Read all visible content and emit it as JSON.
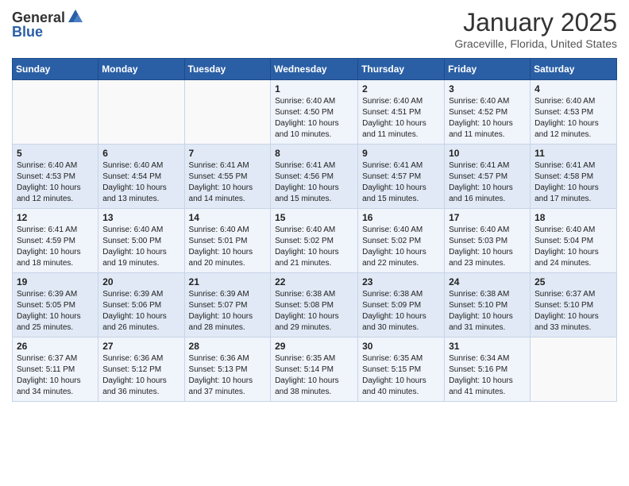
{
  "header": {
    "logo_general": "General",
    "logo_blue": "Blue",
    "month": "January 2025",
    "location": "Graceville, Florida, United States"
  },
  "days_of_week": [
    "Sunday",
    "Monday",
    "Tuesday",
    "Wednesday",
    "Thursday",
    "Friday",
    "Saturday"
  ],
  "weeks": [
    [
      {
        "day": "",
        "info": ""
      },
      {
        "day": "",
        "info": ""
      },
      {
        "day": "",
        "info": ""
      },
      {
        "day": "1",
        "info": "Sunrise: 6:40 AM\nSunset: 4:50 PM\nDaylight: 10 hours and 10 minutes."
      },
      {
        "day": "2",
        "info": "Sunrise: 6:40 AM\nSunset: 4:51 PM\nDaylight: 10 hours and 11 minutes."
      },
      {
        "day": "3",
        "info": "Sunrise: 6:40 AM\nSunset: 4:52 PM\nDaylight: 10 hours and 11 minutes."
      },
      {
        "day": "4",
        "info": "Sunrise: 6:40 AM\nSunset: 4:53 PM\nDaylight: 10 hours and 12 minutes."
      }
    ],
    [
      {
        "day": "5",
        "info": "Sunrise: 6:40 AM\nSunset: 4:53 PM\nDaylight: 10 hours and 12 minutes."
      },
      {
        "day": "6",
        "info": "Sunrise: 6:40 AM\nSunset: 4:54 PM\nDaylight: 10 hours and 13 minutes."
      },
      {
        "day": "7",
        "info": "Sunrise: 6:41 AM\nSunset: 4:55 PM\nDaylight: 10 hours and 14 minutes."
      },
      {
        "day": "8",
        "info": "Sunrise: 6:41 AM\nSunset: 4:56 PM\nDaylight: 10 hours and 15 minutes."
      },
      {
        "day": "9",
        "info": "Sunrise: 6:41 AM\nSunset: 4:57 PM\nDaylight: 10 hours and 15 minutes."
      },
      {
        "day": "10",
        "info": "Sunrise: 6:41 AM\nSunset: 4:57 PM\nDaylight: 10 hours and 16 minutes."
      },
      {
        "day": "11",
        "info": "Sunrise: 6:41 AM\nSunset: 4:58 PM\nDaylight: 10 hours and 17 minutes."
      }
    ],
    [
      {
        "day": "12",
        "info": "Sunrise: 6:41 AM\nSunset: 4:59 PM\nDaylight: 10 hours and 18 minutes."
      },
      {
        "day": "13",
        "info": "Sunrise: 6:40 AM\nSunset: 5:00 PM\nDaylight: 10 hours and 19 minutes."
      },
      {
        "day": "14",
        "info": "Sunrise: 6:40 AM\nSunset: 5:01 PM\nDaylight: 10 hours and 20 minutes."
      },
      {
        "day": "15",
        "info": "Sunrise: 6:40 AM\nSunset: 5:02 PM\nDaylight: 10 hours and 21 minutes."
      },
      {
        "day": "16",
        "info": "Sunrise: 6:40 AM\nSunset: 5:02 PM\nDaylight: 10 hours and 22 minutes."
      },
      {
        "day": "17",
        "info": "Sunrise: 6:40 AM\nSunset: 5:03 PM\nDaylight: 10 hours and 23 minutes."
      },
      {
        "day": "18",
        "info": "Sunrise: 6:40 AM\nSunset: 5:04 PM\nDaylight: 10 hours and 24 minutes."
      }
    ],
    [
      {
        "day": "19",
        "info": "Sunrise: 6:39 AM\nSunset: 5:05 PM\nDaylight: 10 hours and 25 minutes."
      },
      {
        "day": "20",
        "info": "Sunrise: 6:39 AM\nSunset: 5:06 PM\nDaylight: 10 hours and 26 minutes."
      },
      {
        "day": "21",
        "info": "Sunrise: 6:39 AM\nSunset: 5:07 PM\nDaylight: 10 hours and 28 minutes."
      },
      {
        "day": "22",
        "info": "Sunrise: 6:38 AM\nSunset: 5:08 PM\nDaylight: 10 hours and 29 minutes."
      },
      {
        "day": "23",
        "info": "Sunrise: 6:38 AM\nSunset: 5:09 PM\nDaylight: 10 hours and 30 minutes."
      },
      {
        "day": "24",
        "info": "Sunrise: 6:38 AM\nSunset: 5:10 PM\nDaylight: 10 hours and 31 minutes."
      },
      {
        "day": "25",
        "info": "Sunrise: 6:37 AM\nSunset: 5:10 PM\nDaylight: 10 hours and 33 minutes."
      }
    ],
    [
      {
        "day": "26",
        "info": "Sunrise: 6:37 AM\nSunset: 5:11 PM\nDaylight: 10 hours and 34 minutes."
      },
      {
        "day": "27",
        "info": "Sunrise: 6:36 AM\nSunset: 5:12 PM\nDaylight: 10 hours and 36 minutes."
      },
      {
        "day": "28",
        "info": "Sunrise: 6:36 AM\nSunset: 5:13 PM\nDaylight: 10 hours and 37 minutes."
      },
      {
        "day": "29",
        "info": "Sunrise: 6:35 AM\nSunset: 5:14 PM\nDaylight: 10 hours and 38 minutes."
      },
      {
        "day": "30",
        "info": "Sunrise: 6:35 AM\nSunset: 5:15 PM\nDaylight: 10 hours and 40 minutes."
      },
      {
        "day": "31",
        "info": "Sunrise: 6:34 AM\nSunset: 5:16 PM\nDaylight: 10 hours and 41 minutes."
      },
      {
        "day": "",
        "info": ""
      }
    ]
  ]
}
